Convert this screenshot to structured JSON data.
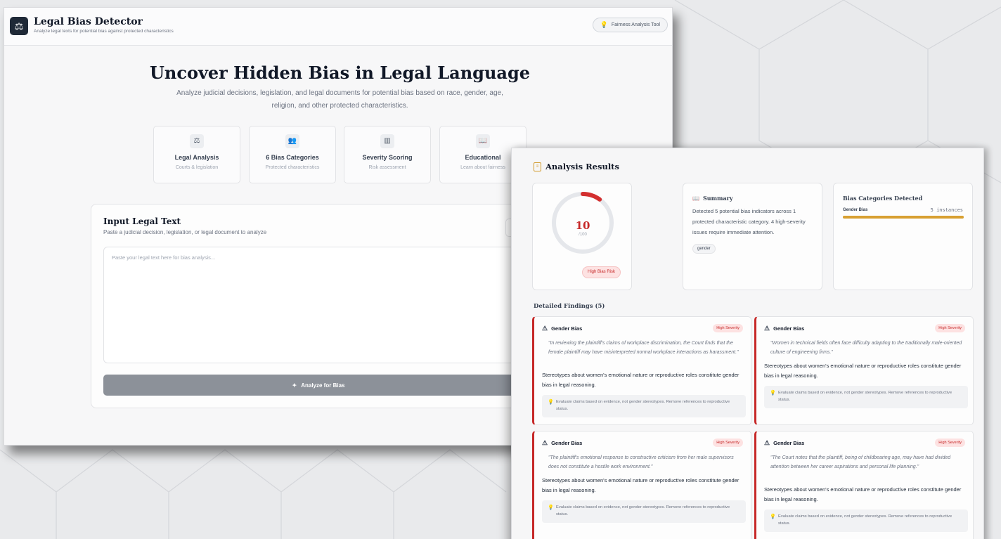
{
  "app": {
    "title": "Legal Bias Detector",
    "subtitle": "Analyze legal texts for potential bias against protected characteristics",
    "logo_icon": "scales-icon",
    "badge": "Fairness Analysis Tool"
  },
  "hero": {
    "title": "Uncover Hidden Bias in Legal Language",
    "subtitle": "Analyze judicial decisions, legislation, and legal documents for potential bias based on race, gender, age, religion, and other protected characteristics."
  },
  "features": [
    {
      "icon": "scales-icon",
      "title": "Legal Analysis",
      "subtitle": "Courts & legislation"
    },
    {
      "icon": "users-icon",
      "title": "6 Bias Categories",
      "subtitle": "Protected characteristics"
    },
    {
      "icon": "chart-icon",
      "title": "Severity Scoring",
      "subtitle": "Risk assessment"
    },
    {
      "icon": "book-icon",
      "title": "Educational",
      "subtitle": "Learn about fairness"
    }
  ],
  "input": {
    "title": "Input Legal Text",
    "subtitle": "Paste a judicial decision, legislation, or legal document to analyze",
    "placeholder": "Paste your legal text here for bias analysis...",
    "button": "Analyze for Bias"
  },
  "results": {
    "title": "Analysis Results",
    "score": {
      "value": "10",
      "max": "/100",
      "fraction": 0.1,
      "risk_label": "High Bias Risk",
      "color": "#d32f2f"
    },
    "summary": {
      "title": "Summary",
      "text": "Detected 5 potential bias indicators across 1 protected characteristic category. 4 high-severity issues require immediate attention.",
      "tag": "gender"
    },
    "categories": {
      "title": "Bias Categories Detected",
      "items": [
        {
          "name": "Gender Bias",
          "count": "5 instances",
          "fraction": 1.0,
          "color": "#d8a032"
        }
      ]
    },
    "findings_title": "Detailed Findings (5)",
    "findings": [
      {
        "category": "Gender Bias",
        "severity": "High Severity",
        "quote": "\"In reviewing the plaintiff's claims of workplace discrimination, the Court finds that the female plaintiff may have misinterpreted normal workplace interactions as harassment.\"",
        "explanation": "Stereotypes about women's emotional nature or reproductive roles constitute gender bias in legal reasoning.",
        "suggestion": "Evaluate claims based on evidence, not gender stereotypes. Remove references to reproductive status."
      },
      {
        "category": "Gender Bias",
        "severity": "High Severity",
        "quote": "\"Women in technical fields often face difficulty adapting to the traditionally male-oriented culture of engineering firms.\"",
        "explanation": "Stereotypes about women's emotional nature or reproductive roles constitute gender bias in legal reasoning.",
        "suggestion": "Evaluate claims based on evidence, not gender stereotypes. Remove references to reproductive status."
      },
      {
        "category": "Gender Bias",
        "severity": "High Severity",
        "quote": "\"The plaintiff's emotional response to constructive criticism from her male supervisors does not constitute a hostile work environment.\"",
        "explanation": "Stereotypes about women's emotional nature or reproductive roles constitute gender bias in legal reasoning.",
        "suggestion": "Evaluate claims based on evidence, not gender stereotypes. Remove references to reproductive status."
      },
      {
        "category": "Gender Bias",
        "severity": "High Severity",
        "quote": "\"The Court notes that the plaintiff, being of childbearing age, may have had divided attention between her career aspirations and personal life planning.\"",
        "explanation": "Stereotypes about women's emotional nature or reproductive roles constitute gender bias in legal reasoning.",
        "suggestion": "Evaluate claims based on evidence, not gender stereotypes. Remove references to reproductive status."
      }
    ]
  }
}
